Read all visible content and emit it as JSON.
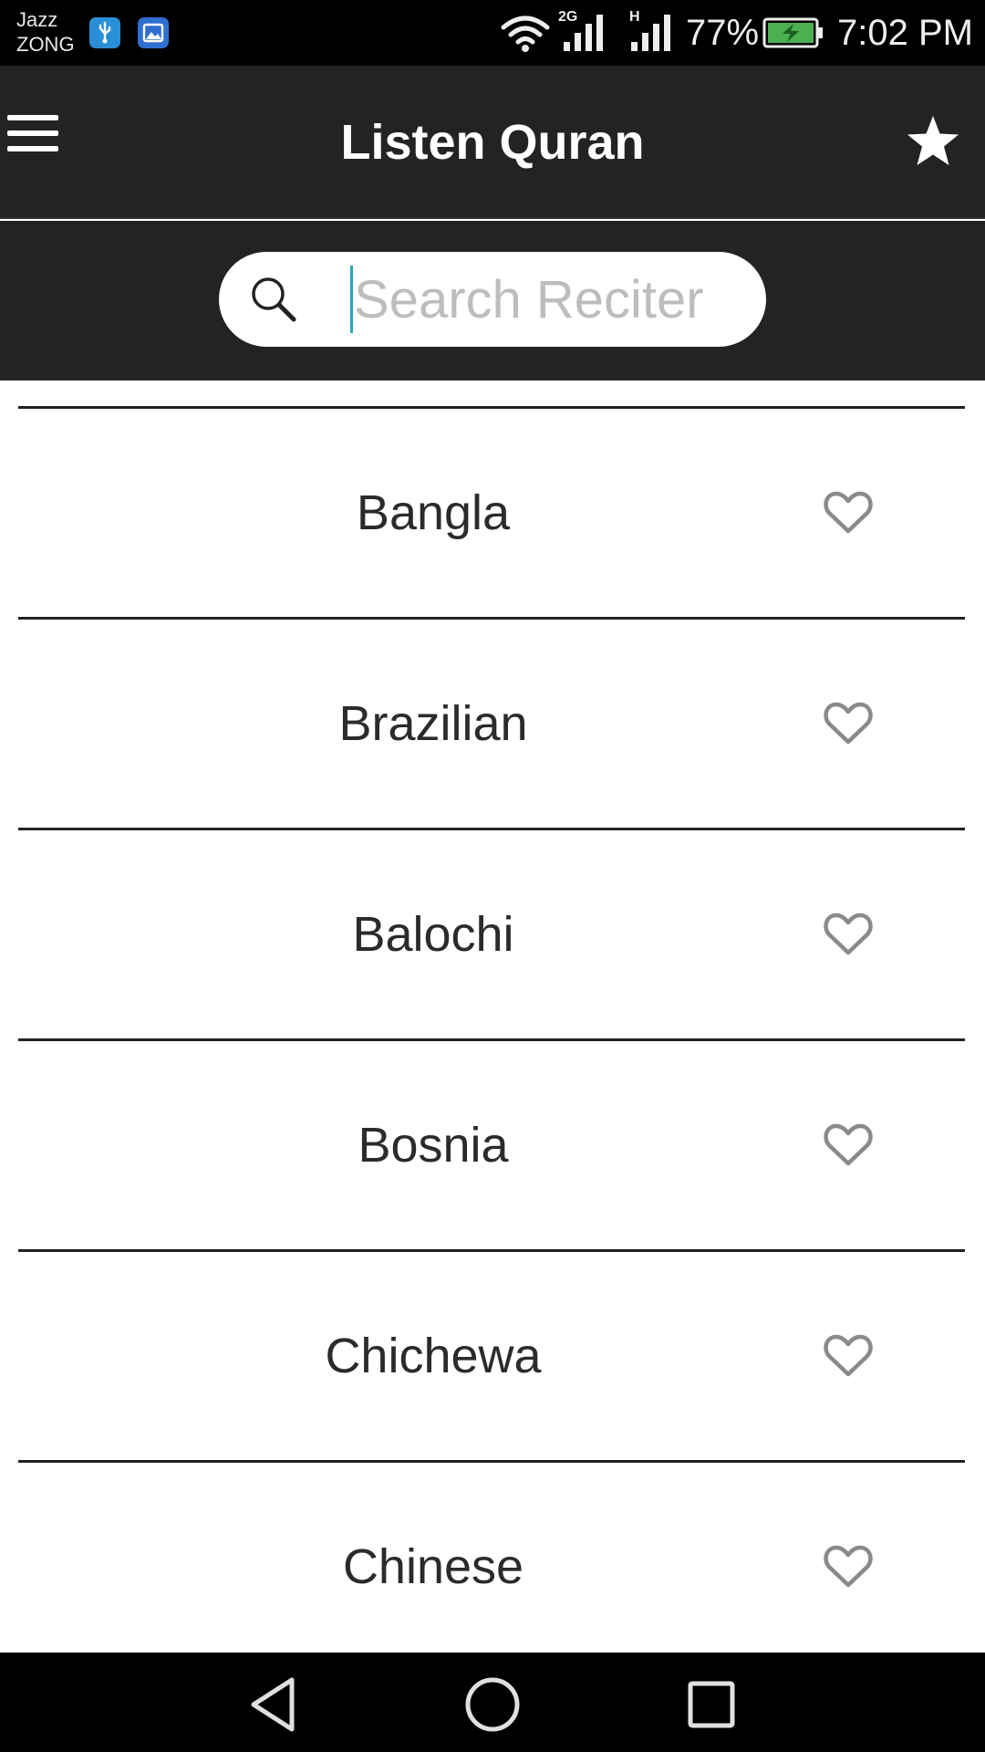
{
  "status_bar": {
    "carrier_1": "Jazz",
    "carrier_2": "ZONG",
    "net_type_1": "2G",
    "net_type_2": "H",
    "battery_percent": "77%",
    "time": "7:02 PM",
    "icons": [
      "usb-icon",
      "gallery-icon",
      "wifi-icon",
      "signal-icon",
      "signal-icon",
      "battery-charging-icon"
    ]
  },
  "app_bar": {
    "title": "Listen Quran",
    "menu_icon": "hamburger-menu-icon",
    "favorite_icon": "star-icon"
  },
  "search": {
    "placeholder": "Search Reciter",
    "value": "",
    "icon": "search-icon"
  },
  "list": {
    "items": [
      {
        "label": "Bangla",
        "favorite": false
      },
      {
        "label": "Brazilian",
        "favorite": false
      },
      {
        "label": "Balochi",
        "favorite": false
      },
      {
        "label": "Bosnia",
        "favorite": false
      },
      {
        "label": "Chichewa",
        "favorite": false
      },
      {
        "label": "Chinese",
        "favorite": false
      }
    ],
    "favorite_icon": "heart-outline-icon"
  },
  "nav_bar": {
    "buttons": [
      "back-triangle-icon",
      "home-circle-icon",
      "recents-square-icon"
    ]
  },
  "colors": {
    "app_bar_bg": "#232323",
    "status_bar_bg": "#000000",
    "caret": "#2aa6b8",
    "battery": "#4caf50"
  }
}
